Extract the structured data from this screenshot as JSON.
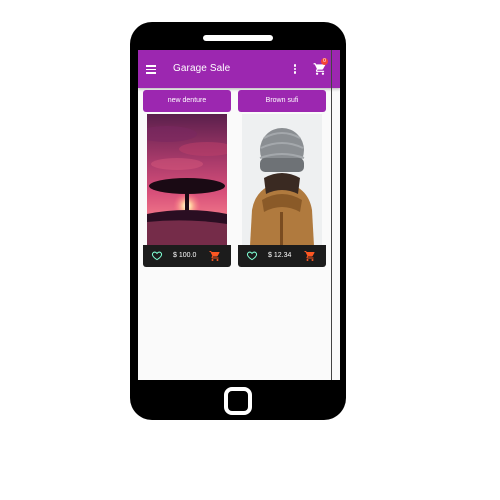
{
  "app": {
    "title": "Garage Sale",
    "cart_count": "0",
    "icons": {
      "menu": "hamburger-menu-icon",
      "more": "vertical-ellipsis-icon",
      "cart": "shopping-cart-icon",
      "favorite": "heart-outline-icon",
      "add_to_cart": "add-shopping-cart-icon"
    }
  },
  "colors": {
    "primary": "#9c27b0",
    "badge": "#f44336",
    "card_footer": "#1c1c1c",
    "heart": "#7fffd4",
    "cart_action": "#ff5722"
  },
  "products": [
    {
      "name": "new denture",
      "price": "$ 100.0"
    },
    {
      "name": "Brown sufi",
      "price": "$ 12.34"
    }
  ]
}
